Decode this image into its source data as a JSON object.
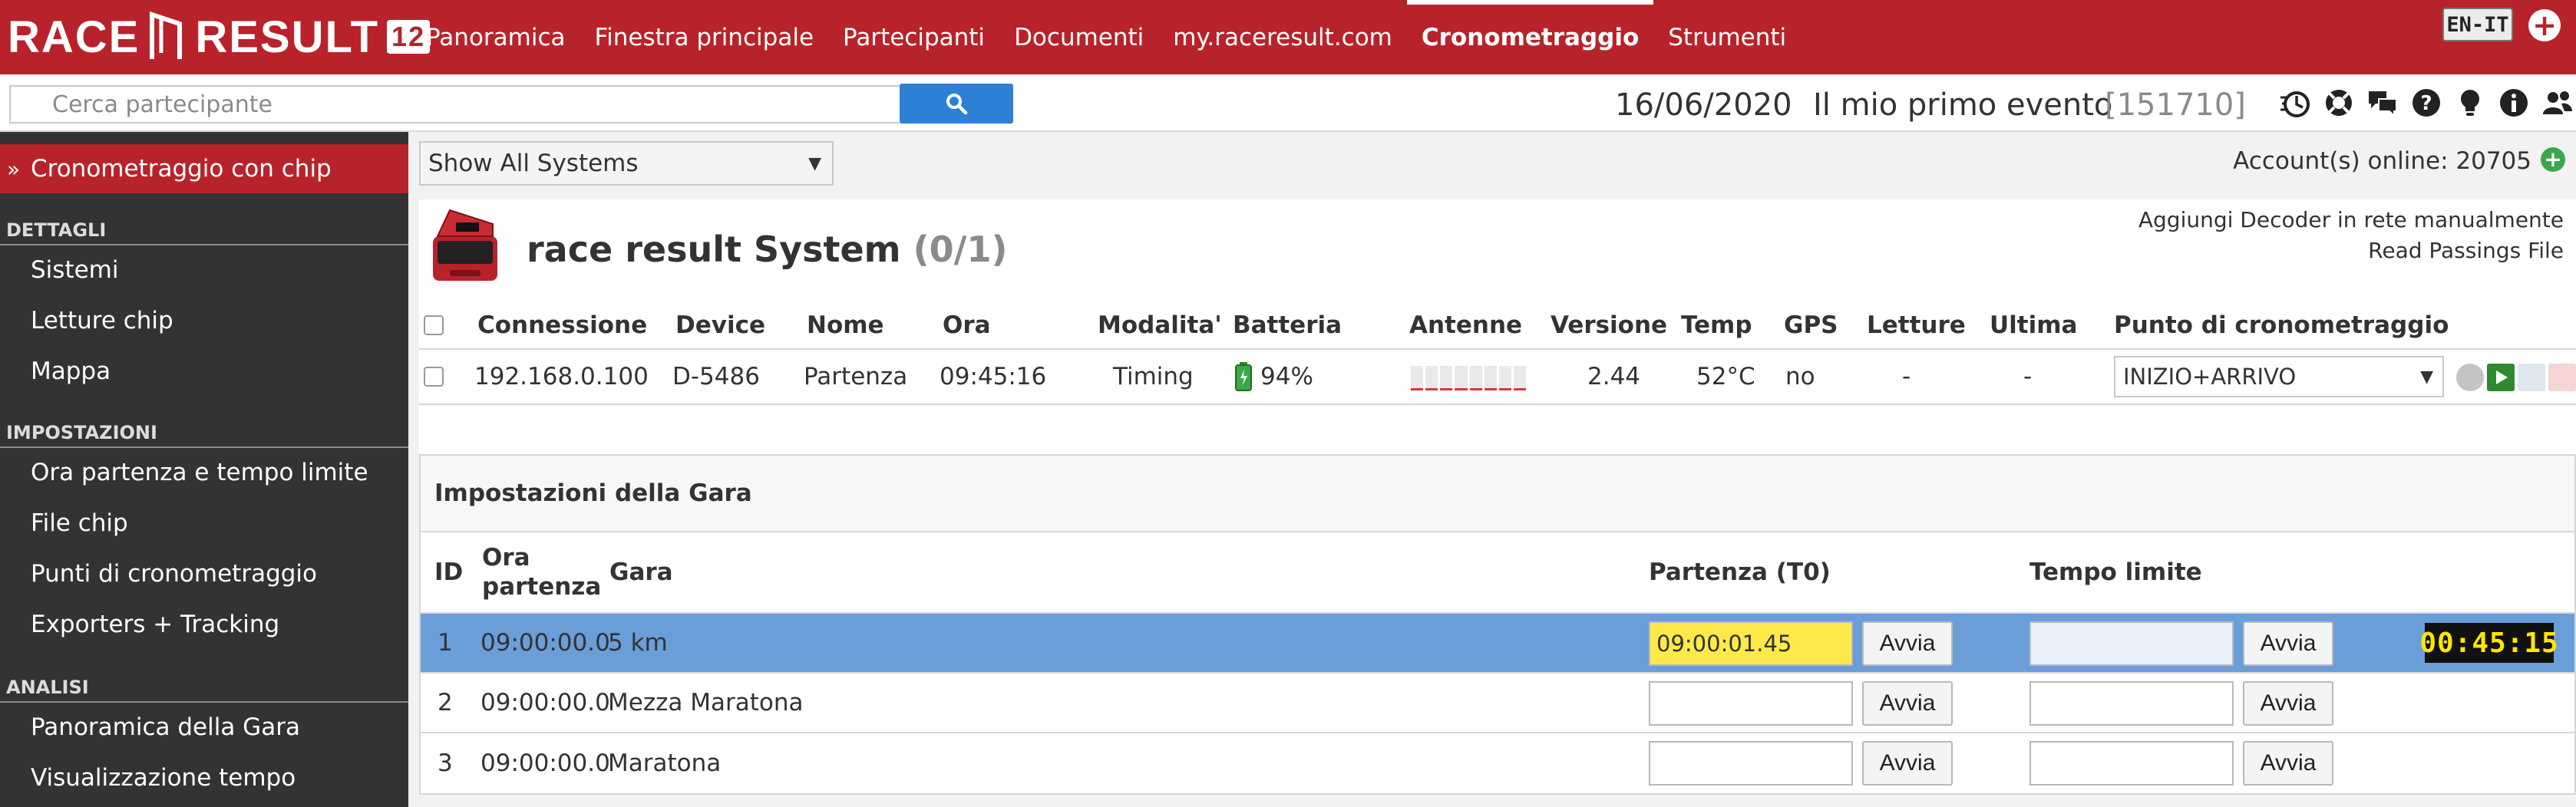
{
  "app": {
    "brand": "RACE RESULT",
    "version": "12"
  },
  "nav": [
    {
      "label": "Panoramica"
    },
    {
      "label": "Finestra principale"
    },
    {
      "label": "Partecipanti"
    },
    {
      "label": "Documenti"
    },
    {
      "label": "my.raceresult.com"
    },
    {
      "label": "Cronometraggio",
      "active": true
    },
    {
      "label": "Strumenti"
    }
  ],
  "lang": "EN-IT",
  "search": {
    "placeholder": "Cerca partecipante",
    "value": ""
  },
  "event": {
    "date": "16/06/2020",
    "name": "Il mio primo evento",
    "id": "[151710]"
  },
  "toolbar_icons": [
    "timing-icon",
    "help-lifebuoy-icon",
    "chat-icon",
    "question-icon",
    "lightbulb-icon",
    "info-icon",
    "users-icon"
  ],
  "sidebar": {
    "active": "Cronometraggio con chip",
    "sections": [
      {
        "title": "DETTAGLI",
        "items": [
          "Sistemi",
          "Letture chip",
          "Mappa"
        ]
      },
      {
        "title": "IMPOSTAZIONI",
        "items": [
          "Ora partenza e tempo limite",
          "File chip",
          "Punti di cronometraggio",
          "Exporters + Tracking"
        ]
      },
      {
        "title": "ANALISI",
        "items": [
          "Panoramica della Gara",
          "Visualizzazione tempo"
        ]
      }
    ]
  },
  "systems_filter": "Show All Systems",
  "accounts_online": "Account(s) online: 20705",
  "system": {
    "title": "race result System",
    "count": "(0/1)",
    "link_add": "Aggiungi Decoder in rete manualmente",
    "link_read": "Read Passings File",
    "columns": [
      "Connessione",
      "Device",
      "Nome",
      "Ora",
      "Modalita'",
      "Batteria",
      "Antenne",
      "Versione",
      "Temp",
      "GPS",
      "Letture",
      "Ultima",
      "Punto di cronometraggio"
    ],
    "row": {
      "connessione": "192.168.0.100",
      "device": "D-5486",
      "nome": "Partenza",
      "ora": "09:45:16",
      "modalita": "Timing",
      "batteria": "94%",
      "versione": "2.44",
      "temp": "52°C",
      "gps": "no",
      "letture": "-",
      "ultima": "-",
      "punto": "INIZIO+ARRIVO"
    }
  },
  "race_settings": {
    "title": "Impostazioni della Gara",
    "columns": {
      "id": "ID",
      "ora_partenza": "Ora partenza",
      "gara": "Gara",
      "partenza": "Partenza (T0)",
      "limite": "Tempo limite"
    },
    "start_label": "Avvia",
    "rows": [
      {
        "id": "1",
        "ora": "09:00:00.0",
        "gara": "5 km",
        "partenza": "09:00:01.45",
        "limite": "",
        "selected": true
      },
      {
        "id": "2",
        "ora": "09:00:00.0",
        "gara": "Mezza Maratona",
        "partenza": "",
        "limite": ""
      },
      {
        "id": "3",
        "ora": "09:00:00.0",
        "gara": "Maratona",
        "partenza": "",
        "limite": ""
      }
    ],
    "clock": "00:45:15"
  },
  "colors": {
    "brand_red": "#b8232b",
    "sidebar": "#333333",
    "selected_row": "#6a9ed8",
    "search_button": "#2e80d6",
    "clock_digits": "#ffe600"
  }
}
